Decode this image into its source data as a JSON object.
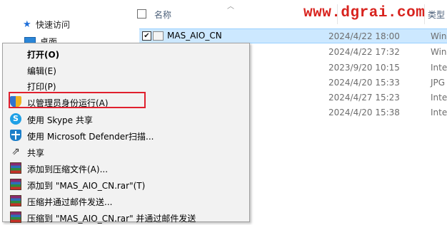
{
  "watermark": "www.dgrai.com",
  "nav": {
    "quick_access": "快速访问",
    "desktop": "桌面"
  },
  "header": {
    "col_name": "名称",
    "col_type": "类型",
    "sort_icon": "chevron-up-icon"
  },
  "files": [
    {
      "name": "MAS_AIO_CN",
      "date": "2024/4/22 18:00",
      "type": "Win",
      "selected": true
    },
    {
      "name": "",
      "date": "2024/4/22 17:32",
      "type": "Win"
    },
    {
      "name": "",
      "date": "2023/9/20 10:15",
      "type": "Inte"
    },
    {
      "name": "",
      "date": "2024/4/20 15:33",
      "type": "JPG"
    },
    {
      "name": "",
      "date": "2024/4/27 15:23",
      "type": "Inte"
    },
    {
      "name": "",
      "date": "2024/4/20 15:38",
      "type": "Inte"
    }
  ],
  "menu": {
    "highlight_color": "#e0202e",
    "items": [
      {
        "label": "打开(O)",
        "bold": true,
        "icon": ""
      },
      {
        "label": "编辑(E)",
        "icon": ""
      },
      {
        "label": "打印(P)",
        "icon": ""
      },
      {
        "label": "以管理员身份运行(A)",
        "icon": "uac-shield-icon"
      },
      {
        "label": "使用 Skype 共享",
        "icon": "skype-icon"
      },
      {
        "label": "使用 Microsoft Defender扫描...",
        "icon": "defender-icon"
      },
      {
        "label": "共享",
        "icon": "share-icon"
      },
      {
        "label": "添加到压缩文件(A)...",
        "icon": "winrar-icon"
      },
      {
        "label": "添加到 \"MAS_AIO_CN.rar\"(T)",
        "icon": "winrar-icon"
      },
      {
        "label": "压缩并通过邮件发送...",
        "icon": "winrar-icon"
      },
      {
        "label": "压缩到 \"MAS_AIO_CN.rar\" 并通过邮件发送",
        "icon": "winrar-icon"
      }
    ]
  }
}
